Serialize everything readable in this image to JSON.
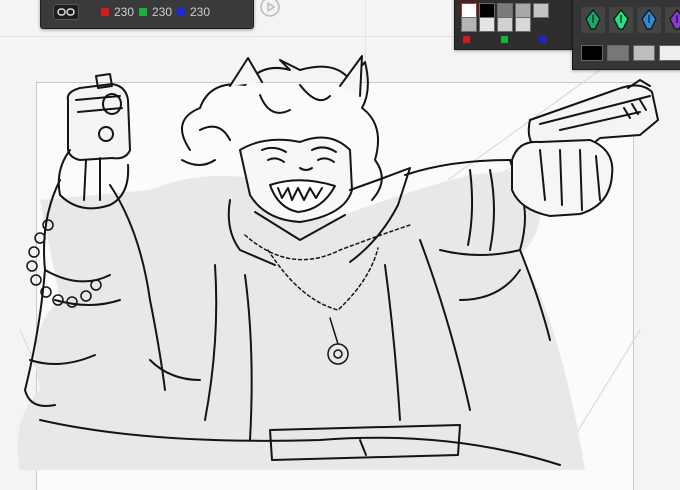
{
  "color_slider": {
    "red_value": "230",
    "green_value": "230",
    "blue_value": "230",
    "red_color": "#d11c1c",
    "green_color": "#19b33a",
    "blue_color": "#1a2ad6"
  },
  "palette": {
    "cells": [
      "#ffffff",
      "#000000",
      "#7a7a7a",
      "#a8a8a8",
      "#c4c4c4",
      "#b4b4b4",
      "#e4e4e4",
      "#d0d0d0",
      "#d8d8d8"
    ],
    "markers": [
      "#d41c1c",
      "#18b531",
      "#1b25d6"
    ]
  },
  "subtools": {
    "tools": [
      "pen-nib-icon",
      "marker-icon",
      "ink-pen-icon",
      "brush-icon"
    ],
    "tool_colors": [
      "#1aa86a",
      "#2ae07f",
      "#2d8ad8",
      "#8a3ad8"
    ],
    "tones": [
      "#000000",
      "#777777",
      "#bdbdbd",
      "#eeeeee"
    ]
  },
  "canvas": {
    "background": "#fbfbfb",
    "line_color": "#141414"
  }
}
